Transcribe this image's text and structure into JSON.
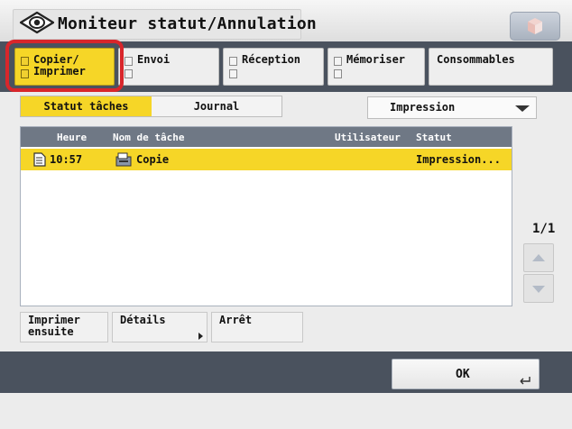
{
  "window": {
    "title": "Moniteur statut/Annulation",
    "title_icon": "eye-icon",
    "corner_button_icon": "cube-icon"
  },
  "function_tabs": [
    {
      "label": "Copier/\nImprimer",
      "active": true,
      "highlighted": true
    },
    {
      "label": "Envoi",
      "active": false
    },
    {
      "label": "Réception",
      "active": false
    },
    {
      "label": "Mémoriser",
      "active": false
    },
    {
      "label": "Consommables",
      "active": false
    }
  ],
  "sub_tabs": [
    {
      "label": "Statut tâches",
      "active": true
    },
    {
      "label": "Journal",
      "active": false
    }
  ],
  "filter_dropdown": {
    "selected": "Impression",
    "icon": "chevron-down-icon"
  },
  "job_table": {
    "columns": [
      "Heure",
      "Nom de tâche",
      "Utilisateur",
      "Statut"
    ],
    "rows": [
      {
        "time": "10:57",
        "name": "Copie",
        "user": "",
        "status": "Impression...",
        "selected": true,
        "icons": [
          "document-icon",
          "copy-job-icon"
        ]
      }
    ]
  },
  "pagination": {
    "label": "1/1",
    "up_icon": "scroll-up-icon",
    "down_icon": "scroll-down-icon"
  },
  "actions": [
    {
      "label": "Imprimer\nensuite"
    },
    {
      "label": "Détails"
    },
    {
      "label": "Arrêt"
    }
  ],
  "ok_button": {
    "label": "OK",
    "icon": "enter-icon"
  },
  "colors": {
    "accent_yellow": "#f6d627",
    "bar_dark": "#4a525e",
    "header_gray": "#6f7885",
    "highlight_red": "#d8262b"
  }
}
